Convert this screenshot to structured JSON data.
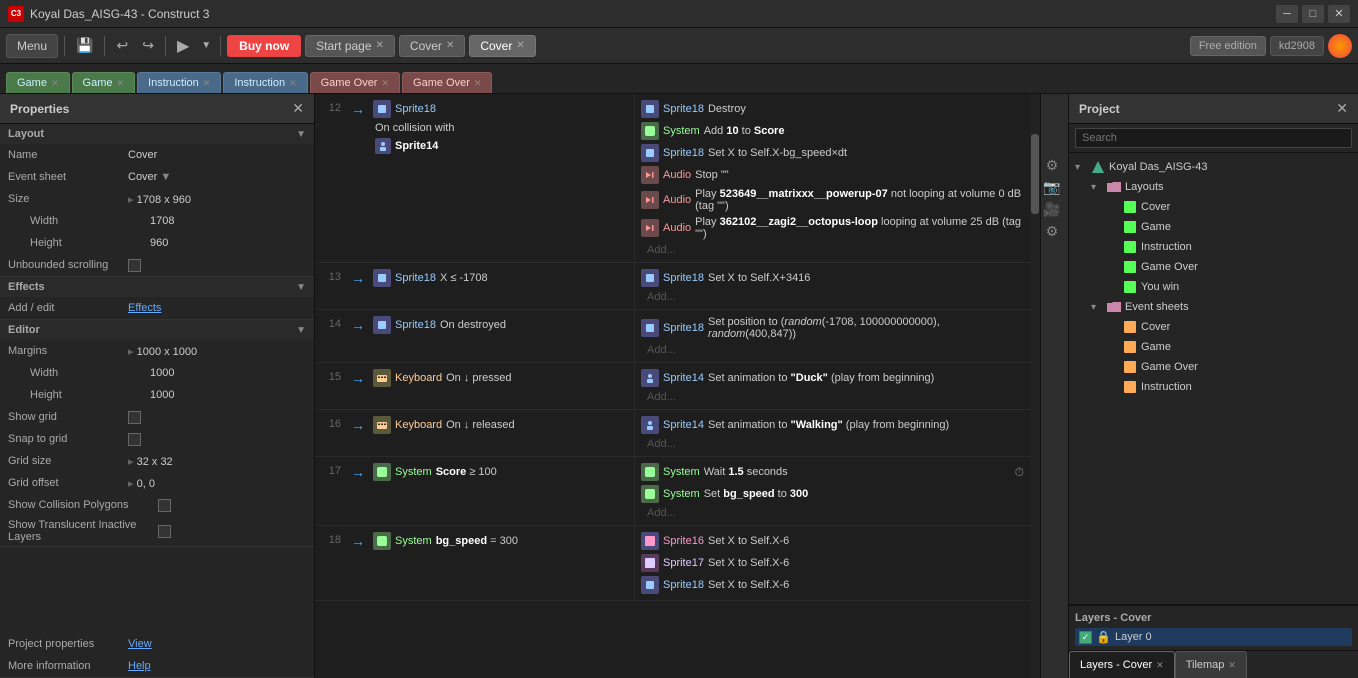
{
  "title_bar": {
    "icon": "C3",
    "title": "Koyal Das_AISG-43 - Construct 3",
    "btn_minimize": "─",
    "btn_maximize": "□",
    "btn_close": "✕"
  },
  "toolbar": {
    "menu_label": "Menu",
    "save_icon": "💾",
    "undo_icon": "↩",
    "redo_icon": "↪",
    "play_icon": "▶",
    "play_arrow": "▼",
    "buy_label": "Buy now",
    "tab_start": "Start page",
    "tab_cover1": "Cover",
    "tab_cover2": "Cover",
    "free_label": "Free edition",
    "user_label": "kd2908"
  },
  "sheet_tabs": [
    {
      "label": "Game",
      "active": false
    },
    {
      "label": "Game",
      "active": true
    },
    {
      "label": "Instruction",
      "active": false
    },
    {
      "label": "Instruction",
      "active": false
    },
    {
      "label": "Game Over",
      "active": false
    },
    {
      "label": "Game Over",
      "active": false
    }
  ],
  "properties": {
    "title": "Properties",
    "layout_label": "Layout",
    "name_label": "Name",
    "name_value": "Cover",
    "event_sheet_label": "Event sheet",
    "event_sheet_value": "Cover",
    "size_label": "Size",
    "size_value": "1708 x 960",
    "width_label": "Width",
    "width_value": "1708",
    "height_label": "Height",
    "height_value": "960",
    "unbounded_label": "Unbounded scrolling",
    "effects_label": "Effects",
    "add_edit_label": "Add / edit",
    "effects_link": "Effects",
    "editor_label": "Editor",
    "margins_label": "Margins",
    "margins_value": "1000 x 1000",
    "margin_width_label": "Width",
    "margin_width_value": "1000",
    "margin_height_label": "Height",
    "margin_height_value": "1000",
    "show_grid_label": "Show grid",
    "snap_grid_label": "Snap to grid",
    "grid_size_label": "Grid size",
    "grid_size_value": "32 x 32",
    "grid_offset_label": "Grid offset",
    "grid_offset_value": "0, 0",
    "show_collision_label": "Show Collision Polygons",
    "show_translucent_label": "Show Translucent Inactive Layers",
    "project_props_label": "Project properties",
    "project_props_link": "View",
    "more_info_label": "More information",
    "more_info_link": "Help"
  },
  "events": [
    {
      "num": "12",
      "conditions": [
        {
          "obj": "Sprite18",
          "obj_type": "sprite",
          "text": "On collision with"
        },
        {
          "obj": "Sprite14",
          "obj_type": "sprite",
          "bold": true
        }
      ],
      "actions": [
        {
          "obj": "Sprite18",
          "obj_type": "sprite",
          "text": "Destroy"
        },
        {
          "obj": "System",
          "obj_type": "system",
          "text": "Add 10 to Score",
          "bold_part": "Score"
        },
        {
          "obj": "Sprite18",
          "obj_type": "sprite",
          "text": "Set X to Self.X-bg_speed×dt"
        },
        {
          "obj": "Audio",
          "obj_type": "audio",
          "text": "Stop \"\""
        },
        {
          "obj": "Audio",
          "obj_type": "audio",
          "text": "Play 523649__matrixxx__powerup-07 not looping at volume 0 dB (tag \"\")"
        },
        {
          "obj": "Audio",
          "obj_type": "audio",
          "text": "Play 362102__zagi2__octopus-loop looping at volume 25 dB (tag \"\")"
        }
      ]
    },
    {
      "num": "13",
      "conditions": [
        {
          "obj": "Sprite18",
          "obj_type": "sprite",
          "text": "X ≤ -1708"
        }
      ],
      "actions": [
        {
          "obj": "Sprite18",
          "obj_type": "sprite",
          "text": "Set X to Self.X+3416"
        }
      ]
    },
    {
      "num": "14",
      "conditions": [
        {
          "obj": "Sprite18",
          "obj_type": "sprite",
          "text": "On destroyed"
        }
      ],
      "actions": [
        {
          "obj": "Sprite18",
          "obj_type": "sprite",
          "text": "Set position to (random(-1708, 100000000000), random(400,847))"
        }
      ]
    },
    {
      "num": "15",
      "conditions": [
        {
          "obj": "Keyboard",
          "obj_type": "keyboard",
          "text": "On ↓ pressed"
        }
      ],
      "actions": [
        {
          "obj": "Sprite14",
          "obj_type": "sprite",
          "text": "Set animation to \"Duck\" (play from beginning)"
        }
      ]
    },
    {
      "num": "16",
      "conditions": [
        {
          "obj": "Keyboard",
          "obj_type": "keyboard",
          "text": "On ↓ released"
        }
      ],
      "actions": [
        {
          "obj": "Sprite14",
          "obj_type": "sprite",
          "text": "Set animation to \"Walking\" (play from beginning)"
        }
      ]
    },
    {
      "num": "17",
      "conditions": [
        {
          "obj": "System",
          "obj_type": "system",
          "text": "Score ≥ 100"
        }
      ],
      "actions": [
        {
          "obj": "System",
          "obj_type": "system",
          "text": "Wait 1.5 seconds",
          "has_timer": true
        },
        {
          "obj": "System",
          "obj_type": "system",
          "text": "Set bg_speed to 300"
        }
      ]
    },
    {
      "num": "18",
      "conditions": [
        {
          "obj": "System",
          "obj_type": "system",
          "text": "bg_speed = 300"
        }
      ],
      "actions": [
        {
          "obj": "Sprite16",
          "obj_type": "sprite",
          "text": "Set X to Self.X-6"
        },
        {
          "obj": "Sprite17",
          "obj_type": "sprite",
          "text": "Set X to Self.X-6"
        },
        {
          "obj": "Sprite18",
          "obj_type": "sprite",
          "text": "Set X to Self.X-6"
        }
      ]
    }
  ],
  "project": {
    "title": "Project",
    "search_placeholder": "Search",
    "root": "Koyal Das_AISG-43",
    "layouts_folder": "Layouts",
    "layouts": [
      "Cover",
      "Game",
      "Instruction",
      "Game Over",
      "You win"
    ],
    "event_sheets_folder": "Event sheets",
    "event_sheets": [
      "Cover",
      "Game",
      "Game Over",
      "Instruction"
    ]
  },
  "layers": {
    "panel_title": "Layers - Cover",
    "items": [
      {
        "name": "Layer 0",
        "visible": true,
        "locked": true
      }
    ]
  },
  "bottom_tabs": [
    {
      "label": "Layers - Cover"
    },
    {
      "label": "Tilemap"
    }
  ]
}
